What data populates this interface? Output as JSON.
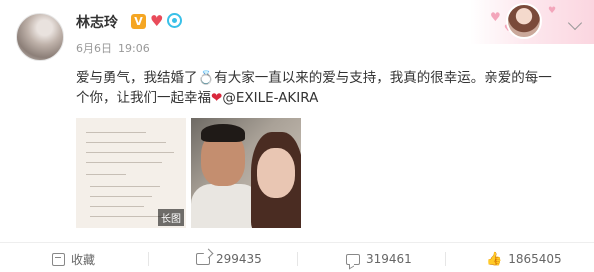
{
  "post": {
    "author_name": "林志玲",
    "verified_badge": "V",
    "date": "6月6日",
    "time": "19:06",
    "content_line1": "爱与勇气，我结婚了💍有大家一直以来的爱与支持，我真的很幸运。亲爱的每一",
    "content_line2_pre": "个你，让我们一起幸福",
    "heart_glyph": "❤",
    "mention": "@EXILE-AKIRA",
    "image_badge": "长图"
  },
  "actions": {
    "favorite_label": "收藏",
    "share_count": "299435",
    "comment_count": "319461",
    "like_count": "1865405"
  },
  "colors": {
    "verified": "#f5a623",
    "heart": "#d9283c",
    "text": "#333333",
    "meta": "#999999"
  }
}
